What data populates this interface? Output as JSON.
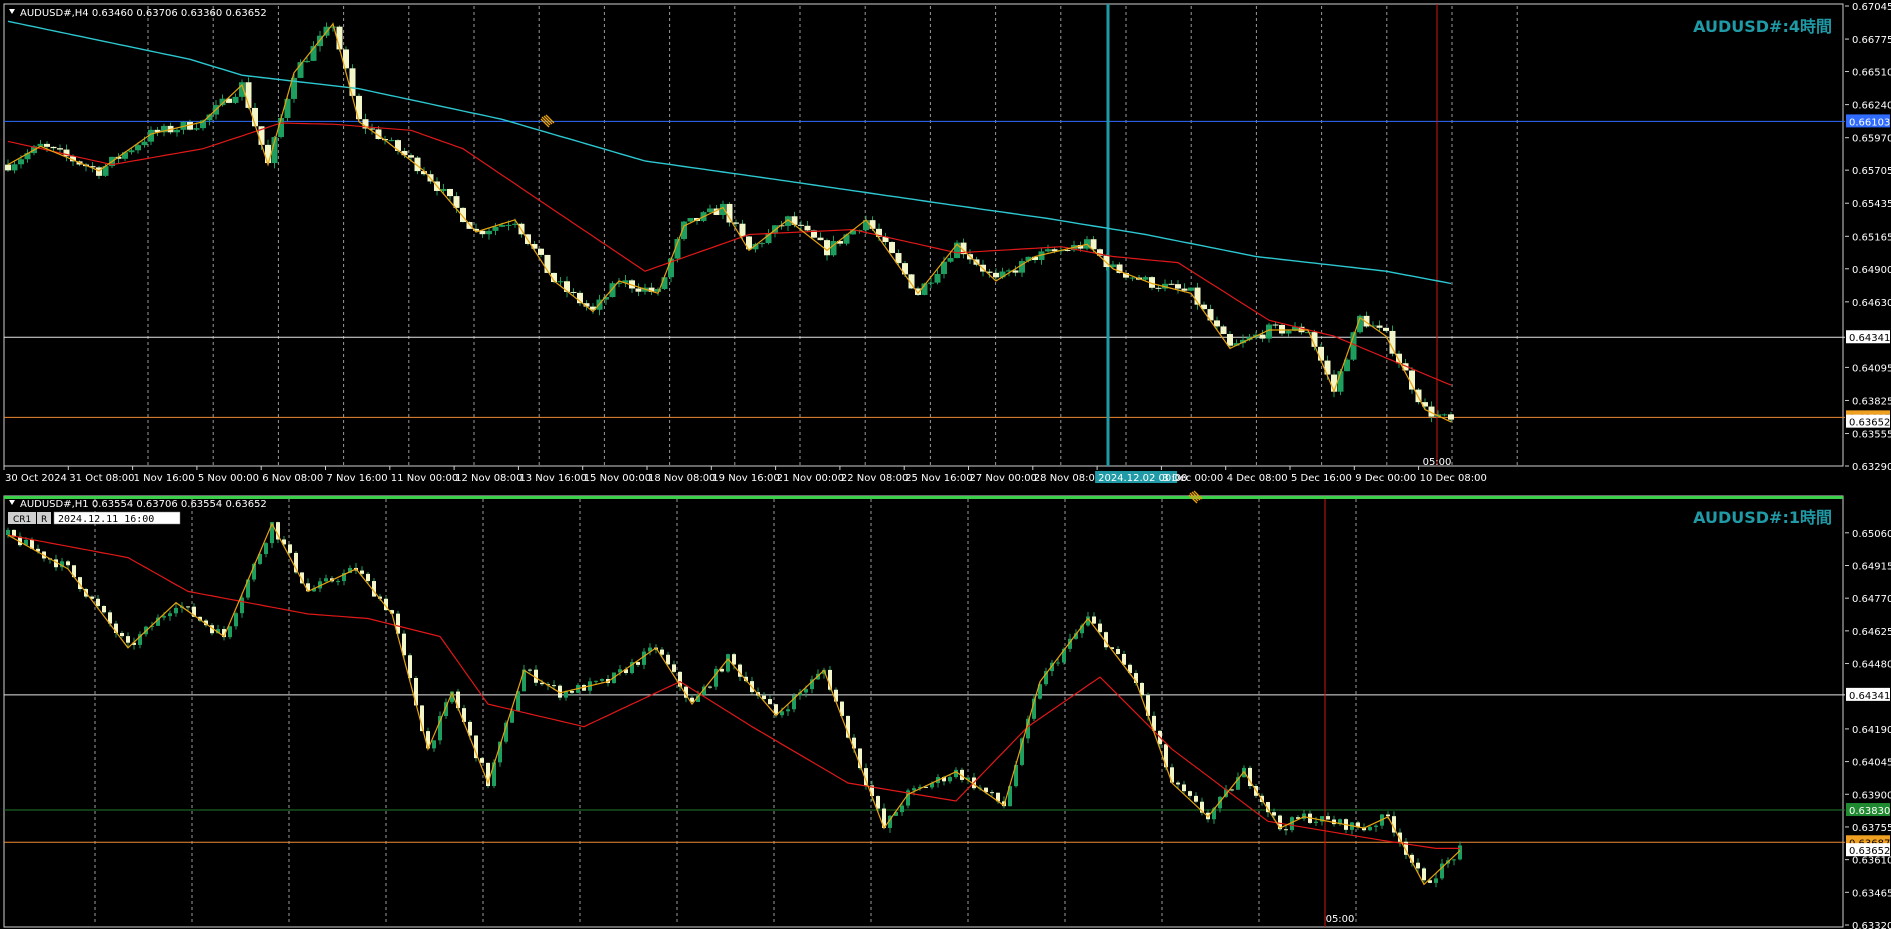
{
  "colors": {
    "background": "#000000",
    "frame": "#d0d0d0",
    "grid": "#9a9a9a",
    "bull_body": "#1e9e5e",
    "bear_body": "#f3f6c8",
    "wick": "#1e9e5e",
    "ma_long": "#2cc7d0",
    "ma_short": "#e01818",
    "zigzag": "#e8a20c",
    "level_white": "#e6e6e6",
    "level_orange": "#f08a32",
    "level_blue": "#2f6cff",
    "level_green": "#1f7a2a",
    "vline_teal": "#1f9aa6",
    "vline_red": "#d01414",
    "label_blue": "#2f6cff",
    "label_orange": "#f0a020",
    "label_green": "#1f8a30",
    "watermark": "#1f9aa6"
  },
  "top": {
    "header": "AUDUSD#,H4  0.63460 0.63706 0.63360 0.63652",
    "watermark": "AUDUSD#:4時間",
    "vline_label": "05:00",
    "highlight_date": "2024.12.02 00:00"
  },
  "bottom": {
    "header": "AUDUSD#,H1  0.63554 0.63706 0.63554 0.63652",
    "watermark": "AUDUSD#:1時間",
    "cr1": "CR1",
    "r_label": "R",
    "date_input": "2024.12.11 16:00",
    "vline_label": "05:00"
  },
  "chart_data": [
    {
      "type": "candlestick",
      "timeframe": "H4",
      "ylim": [
        0.6329,
        0.67045
      ],
      "y_ticks": [
        "0.67045",
        "0.66775",
        "0.66510",
        "0.66240",
        "0.65970",
        "0.65705",
        "0.65435",
        "0.65165",
        "0.64900",
        "0.64630",
        "0.64095",
        "0.63825",
        "0.63555",
        "0.63290"
      ],
      "x_ticks": [
        "30 Oct 2024",
        "31 Oct 08:00",
        "1 Nov 16:00",
        "5 Nov 00:00",
        "6 Nov 08:00",
        "7 Nov 16:00",
        "11 Nov 00:00",
        "12 Nov 08:00",
        "13 Nov 16:00",
        "15 Nov 00:00",
        "18 Nov 08:00",
        "19 Nov 16:00",
        "21 Nov 00:00",
        "22 Nov 08:00",
        "25 Nov 16:00",
        "27 Nov 00:00",
        "28 Nov 08:00",
        "2024.12.02 00:00",
        "3 Dec 00:00",
        "4 Dec 08:00",
        "5 Dec 16:00",
        "9 Dec 00:00",
        "10 Dec 08:00"
      ],
      "price_labels": [
        {
          "value": 0.66103,
          "text": "0.66103",
          "kind": "blue"
        },
        {
          "value": 0.64341,
          "text": "0.64341",
          "kind": "white"
        },
        {
          "value": 0.63687,
          "text": "0.63687",
          "kind": "orange"
        },
        {
          "value": 0.63652,
          "text": "0.63652",
          "kind": "plain"
        }
      ],
      "h_levels": [
        {
          "value": 0.66103,
          "color": "blue"
        },
        {
          "value": 0.64341,
          "color": "white"
        },
        {
          "value": 0.63687,
          "color": "orange"
        }
      ],
      "ma_long_anchors": [
        [
          0,
          0.6692
        ],
        [
          28,
          0.6661
        ],
        [
          36,
          0.6648
        ],
        [
          54,
          0.6637
        ],
        [
          76,
          0.6612
        ],
        [
          98,
          0.6578
        ],
        [
          118,
          0.6563
        ],
        [
          144,
          0.6543
        ],
        [
          160,
          0.6531
        ],
        [
          175,
          0.6518
        ],
        [
          192,
          0.65
        ],
        [
          212,
          0.6488
        ],
        [
          222,
          0.6478
        ]
      ],
      "ma_short_anchors": [
        [
          0,
          0.6594
        ],
        [
          16,
          0.6575
        ],
        [
          30,
          0.6588
        ],
        [
          42,
          0.6609
        ],
        [
          50,
          0.6608
        ],
        [
          62,
          0.6603
        ],
        [
          70,
          0.6588
        ],
        [
          82,
          0.6545
        ],
        [
          98,
          0.6488
        ],
        [
          114,
          0.6518
        ],
        [
          130,
          0.6522
        ],
        [
          146,
          0.6503
        ],
        [
          162,
          0.6508
        ],
        [
          170,
          0.65
        ],
        [
          180,
          0.6495
        ],
        [
          194,
          0.6448
        ],
        [
          204,
          0.6435
        ],
        [
          222,
          0.6395
        ]
      ],
      "close_anchors": [
        [
          0,
          0.6575
        ],
        [
          5,
          0.659
        ],
        [
          14,
          0.657
        ],
        [
          22,
          0.66
        ],
        [
          30,
          0.661
        ],
        [
          36,
          0.664
        ],
        [
          40,
          0.6575
        ],
        [
          44,
          0.665
        ],
        [
          50,
          0.669
        ],
        [
          54,
          0.661
        ],
        [
          58,
          0.6595
        ],
        [
          64,
          0.657
        ],
        [
          72,
          0.652
        ],
        [
          78,
          0.653
        ],
        [
          84,
          0.648
        ],
        [
          90,
          0.6455
        ],
        [
          94,
          0.648
        ],
        [
          100,
          0.647
        ],
        [
          104,
          0.6525
        ],
        [
          110,
          0.654
        ],
        [
          114,
          0.6505
        ],
        [
          120,
          0.653
        ],
        [
          126,
          0.6505
        ],
        [
          132,
          0.653
        ],
        [
          140,
          0.647
        ],
        [
          146,
          0.651
        ],
        [
          152,
          0.648
        ],
        [
          158,
          0.65
        ],
        [
          166,
          0.651
        ],
        [
          170,
          0.649
        ],
        [
          176,
          0.6478
        ],
        [
          182,
          0.647
        ],
        [
          188,
          0.6425
        ],
        [
          194,
          0.644
        ],
        [
          200,
          0.644
        ],
        [
          204,
          0.639
        ],
        [
          208,
          0.645
        ],
        [
          212,
          0.6435
        ],
        [
          218,
          0.6375
        ],
        [
          222,
          0.6365
        ]
      ]
    },
    {
      "type": "candlestick",
      "timeframe": "H1",
      "ylim": [
        0.6332,
        0.6521
      ],
      "y_ticks": [
        "0.65060",
        "0.64915",
        "0.64770",
        "0.64625",
        "0.64480",
        "0.64190",
        "0.64045",
        "0.63900",
        "0.63755",
        "0.63610",
        "0.63465",
        "0.63320"
      ],
      "price_labels": [
        {
          "value": 0.64341,
          "text": "0.64341",
          "kind": "white"
        },
        {
          "value": 0.6383,
          "text": "0.63830",
          "kind": "green"
        },
        {
          "value": 0.63687,
          "text": "0.63687",
          "kind": "orange"
        },
        {
          "value": 0.63652,
          "text": "0.63652",
          "kind": "plain"
        }
      ],
      "h_levels": [
        {
          "value": 0.64341,
          "color": "white"
        },
        {
          "value": 0.6383,
          "color": "green"
        },
        {
          "value": 0.63687,
          "color": "orange"
        }
      ],
      "ma_short_anchors": [
        [
          0,
          0.6505
        ],
        [
          20,
          0.6495
        ],
        [
          30,
          0.648
        ],
        [
          50,
          0.647
        ],
        [
          60,
          0.6468
        ],
        [
          72,
          0.646
        ],
        [
          80,
          0.643
        ],
        [
          96,
          0.642
        ],
        [
          112,
          0.644
        ],
        [
          124,
          0.642
        ],
        [
          140,
          0.6395
        ],
        [
          158,
          0.6387
        ],
        [
          170,
          0.642
        ],
        [
          182,
          0.6442
        ],
        [
          194,
          0.641
        ],
        [
          210,
          0.6378
        ],
        [
          228,
          0.637
        ],
        [
          238,
          0.6366
        ]
      ],
      "close_anchors": [
        [
          0,
          0.6505
        ],
        [
          10,
          0.649
        ],
        [
          20,
          0.6455
        ],
        [
          28,
          0.6475
        ],
        [
          36,
          0.646
        ],
        [
          44,
          0.651
        ],
        [
          50,
          0.648
        ],
        [
          58,
          0.649
        ],
        [
          64,
          0.647
        ],
        [
          70,
          0.641
        ],
        [
          74,
          0.6435
        ],
        [
          80,
          0.6395
        ],
        [
          86,
          0.6445
        ],
        [
          92,
          0.6435
        ],
        [
          100,
          0.644
        ],
        [
          108,
          0.6455
        ],
        [
          114,
          0.643
        ],
        [
          120,
          0.645
        ],
        [
          128,
          0.6425
        ],
        [
          136,
          0.6445
        ],
        [
          146,
          0.6375
        ],
        [
          150,
          0.639
        ],
        [
          158,
          0.64
        ],
        [
          166,
          0.6385
        ],
        [
          172,
          0.644
        ],
        [
          180,
          0.6468
        ],
        [
          188,
          0.644
        ],
        [
          194,
          0.6395
        ],
        [
          200,
          0.638
        ],
        [
          206,
          0.64
        ],
        [
          212,
          0.6375
        ],
        [
          216,
          0.638
        ],
        [
          226,
          0.6375
        ],
        [
          230,
          0.638
        ],
        [
          236,
          0.635
        ],
        [
          242,
          0.6365
        ]
      ]
    }
  ]
}
